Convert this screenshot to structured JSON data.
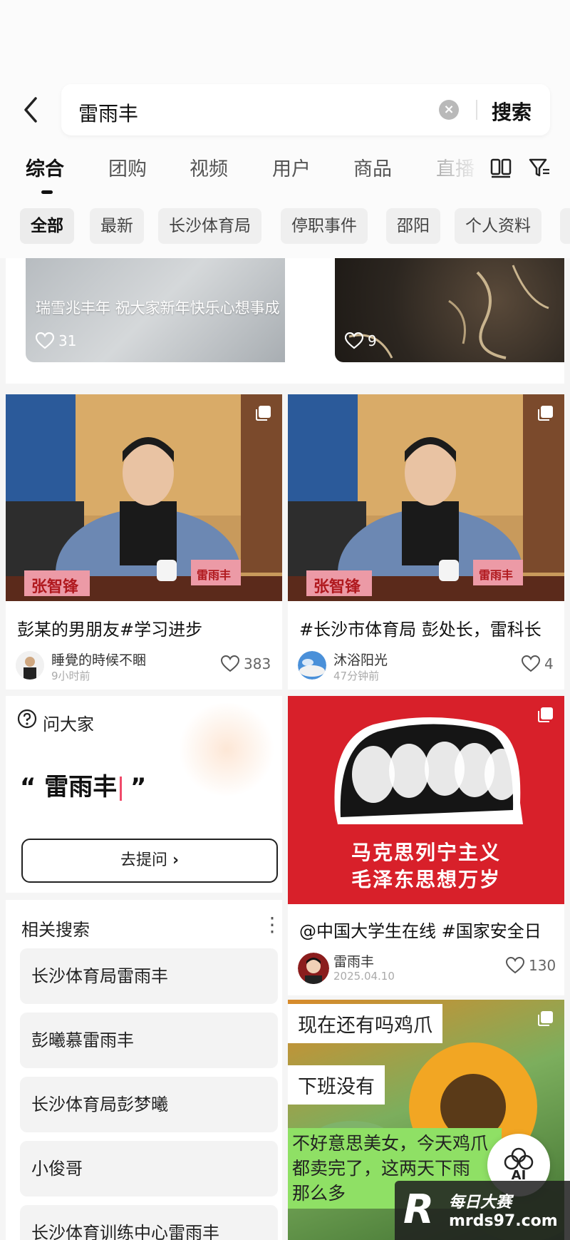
{
  "search": {
    "query": "雷雨丰",
    "submit_label": "搜索"
  },
  "tabs": [
    {
      "label": "综合",
      "active": true
    },
    {
      "label": "团购"
    },
    {
      "label": "视频"
    },
    {
      "label": "用户"
    },
    {
      "label": "商品"
    },
    {
      "label": "直播"
    }
  ],
  "chips": [
    {
      "label": "全部",
      "active": true
    },
    {
      "label": "最新"
    },
    {
      "label": "长沙体育局"
    },
    {
      "label": "停职事件"
    },
    {
      "label": "邵阳"
    },
    {
      "label": "个人资料"
    }
  ],
  "feed": {
    "top_left": {
      "caption": "瑞雪兆丰年  祝大家新年快乐心想事成",
      "likes": "31"
    },
    "top_right": {
      "likes": "9"
    },
    "card1": {
      "nameplate_left": "张智锋",
      "nameplate_right": "雷雨丰",
      "title": "彭某的男朋友#学习进步",
      "author": "睡覺的時候不睏",
      "time": "9小时前",
      "likes": "383"
    },
    "card2": {
      "nameplate_left": "张智锋",
      "nameplate_right": "雷雨丰",
      "title": "#长沙市体育局 彭处长，雷科长",
      "author": "沐浴阳光",
      "time": "47分钟前",
      "likes": "4"
    },
    "ask": {
      "title": "问大家",
      "quote_open": "“",
      "query": "雷雨丰",
      "quote_close": "”",
      "button_label": "去提问",
      "button_arrow": "›"
    },
    "card3": {
      "poster_line1": "马克思列宁主义",
      "poster_line2": "毛泽东思想万岁",
      "title": "@中国大学生在线 #国家安全日",
      "author": "雷雨丰",
      "time": "2025.04.10",
      "likes": "130"
    },
    "related": {
      "title": "相关搜索",
      "more": "⋮",
      "items": [
        "长沙体育局雷雨丰",
        "彭曦慕雷雨丰",
        "长沙体育局彭梦曦",
        "小俊哥",
        "长沙体育训练中心雷雨丰"
      ]
    },
    "card4": {
      "bubble1": "现在还有吗鸡爪",
      "bubble2": "下班没有",
      "bubble3_line1": "不好意思美女，今天鸡爪",
      "bubble3_line2": "都卖完了，这两天下雨",
      "bubble3_line3": "那么多"
    }
  },
  "ai_button": {
    "label": "AI"
  },
  "watermark": {
    "logo": "R",
    "line1": "每日大赛",
    "line2": "mrds97.com"
  },
  "colors": {
    "accent_red": "#d8202a",
    "caret_pink": "#f04a6a",
    "bubble_green": "#8fe065"
  }
}
